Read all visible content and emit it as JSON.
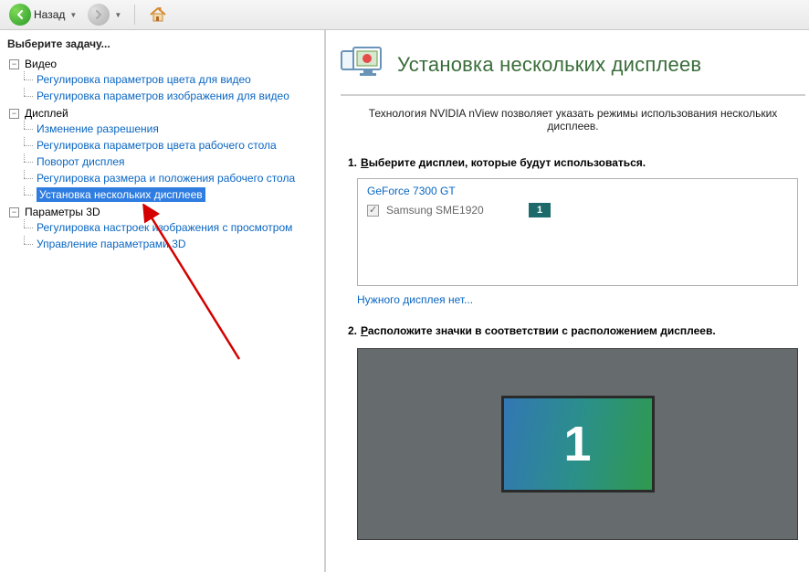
{
  "toolbar": {
    "back_label": "Назад"
  },
  "sidebar": {
    "task_header": "Выберите задачу...",
    "groups": [
      {
        "label": "Видео",
        "items": [
          "Регулировка параметров цвета для видео",
          "Регулировка параметров изображения для видео"
        ]
      },
      {
        "label": "Дисплей",
        "items": [
          "Изменение разрешения",
          "Регулировка параметров цвета рабочего стола",
          "Поворот дисплея",
          "Регулировка размера и положения рабочего стола",
          "Установка нескольких дисплеев"
        ],
        "selected_index": 4
      },
      {
        "label": "Параметры 3D",
        "items": [
          "Регулировка настроек изображения с просмотром",
          "Управление параметрами 3D"
        ]
      }
    ]
  },
  "content": {
    "title": "Установка нескольких дисплеев",
    "intro": "Технология NVIDIA nView позволяет указать режимы использования нескольких дисплеев.",
    "step1_num": "1.",
    "step1_pre": "В",
    "step1_rest": "ыберите дисплеи, которые будут использоваться.",
    "gpu": "GeForce 7300 GT",
    "display_item": "Samsung SME1920",
    "display_badge": "1",
    "missing_link": "Нужного дисплея нет...",
    "step2_num": "2.",
    "step2_pre": "Р",
    "step2_rest": "асположите значки в соответствии с расположением дисплеев.",
    "monitor_number": "1"
  }
}
